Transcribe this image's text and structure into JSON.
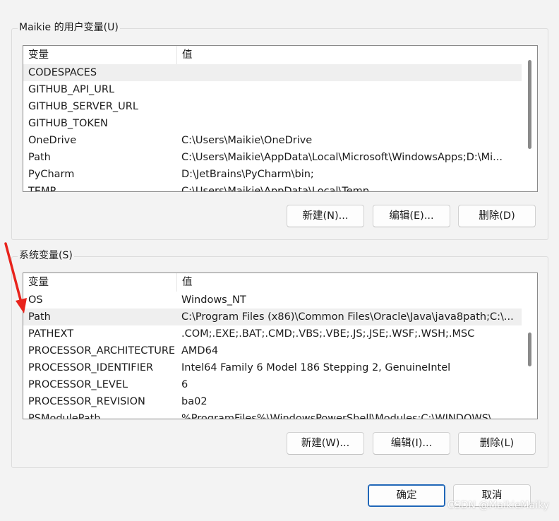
{
  "user_vars": {
    "title": "Maikie 的用户变量(U)",
    "col_name": "变量",
    "col_value": "值",
    "rows": [
      {
        "name": "CODESPACES",
        "value": ""
      },
      {
        "name": "GITHUB_API_URL",
        "value": ""
      },
      {
        "name": "GITHUB_SERVER_URL",
        "value": ""
      },
      {
        "name": "GITHUB_TOKEN",
        "value": ""
      },
      {
        "name": "OneDrive",
        "value": "C:\\Users\\Maikie\\OneDrive"
      },
      {
        "name": "Path",
        "value": "C:\\Users\\Maikie\\AppData\\Local\\Microsoft\\WindowsApps;D:\\Mi..."
      },
      {
        "name": "PyCharm",
        "value": "D:\\JetBrains\\PyCharm\\bin;"
      },
      {
        "name": "TEMP",
        "value": "C:\\Users\\Maikie\\AppData\\Local\\Temp"
      }
    ],
    "buttons": {
      "new": "新建(N)...",
      "edit": "编辑(E)...",
      "delete": "删除(D)"
    }
  },
  "system_vars": {
    "title": "系统变量(S)",
    "col_name": "变量",
    "col_value": "值",
    "rows": [
      {
        "name": "OS",
        "value": "Windows_NT"
      },
      {
        "name": "Path",
        "value": "C:\\Program Files (x86)\\Common Files\\Oracle\\Java\\java8path;C:\\..."
      },
      {
        "name": "PATHEXT",
        "value": ".COM;.EXE;.BAT;.CMD;.VBS;.VBE;.JS;.JSE;.WSF;.WSH;.MSC"
      },
      {
        "name": "PROCESSOR_ARCHITECTURE",
        "value": "AMD64"
      },
      {
        "name": "PROCESSOR_IDENTIFIER",
        "value": "Intel64 Family 6 Model 186 Stepping 2, GenuineIntel"
      },
      {
        "name": "PROCESSOR_LEVEL",
        "value": "6"
      },
      {
        "name": "PROCESSOR_REVISION",
        "value": "ba02"
      },
      {
        "name": "PSModulePath",
        "value": "%ProgramFiles%\\WindowsPowerShell\\Modules;C:\\WINDOWS\\..."
      }
    ],
    "buttons": {
      "new": "新建(W)...",
      "edit": "编辑(I)...",
      "delete": "删除(L)"
    }
  },
  "dialog": {
    "ok": "确定",
    "cancel": "取消"
  },
  "watermark": "CSDN @MaikieMaiky",
  "colors": {
    "arrow": "#e8231c",
    "accent": "#2067b8",
    "selected_row": "#efefef"
  },
  "icons": {
    "annotation": "red-arrow-icon"
  }
}
